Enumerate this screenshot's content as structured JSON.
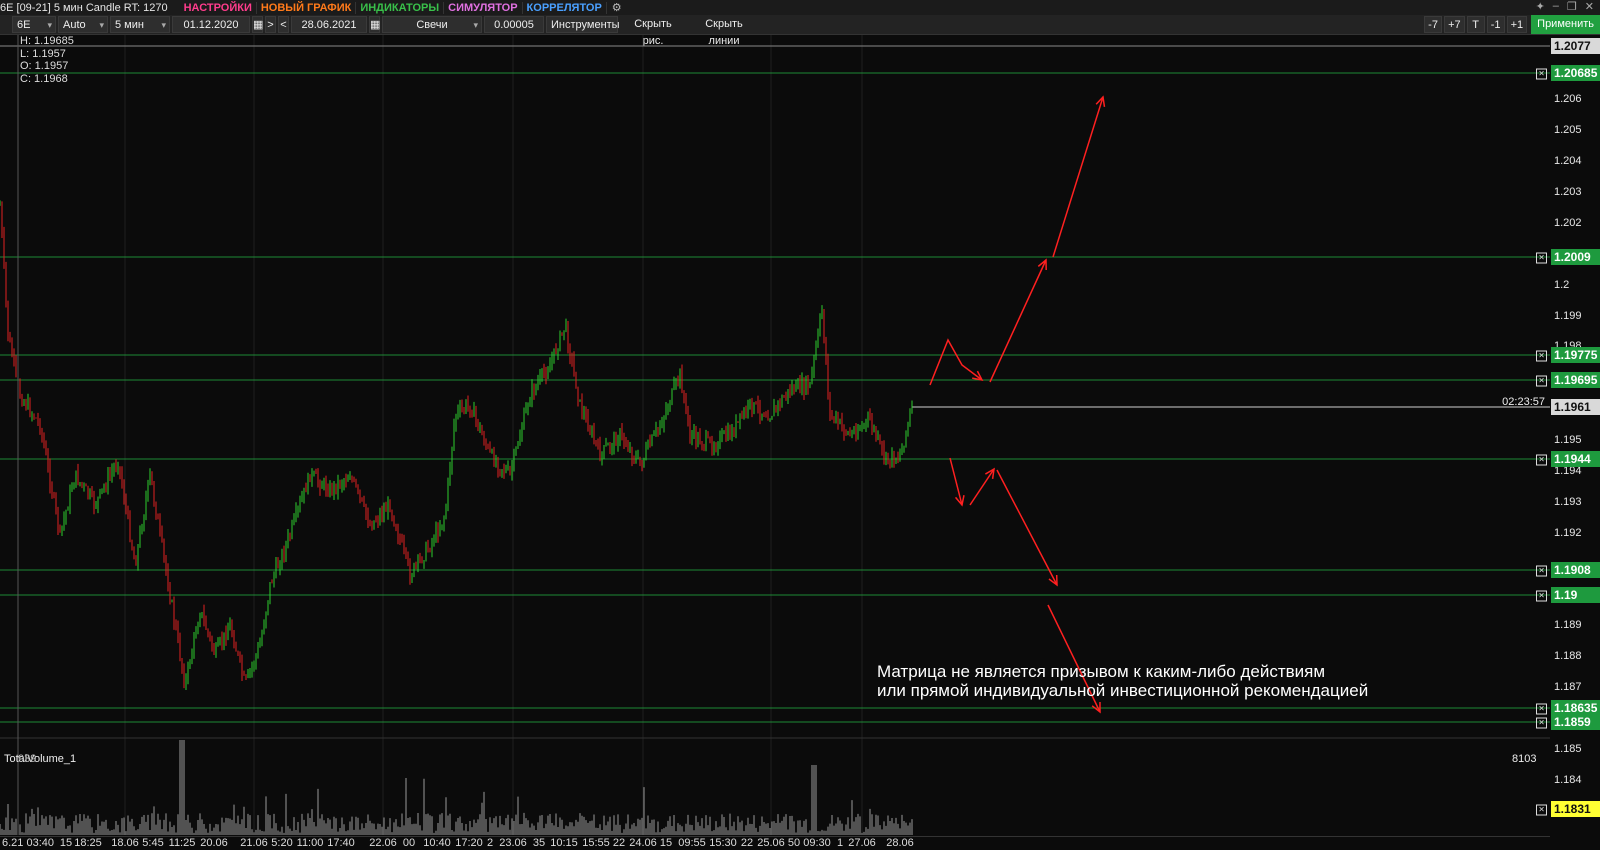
{
  "titlebar": {
    "title": "6E [09-21] 5 мин Candle RT: 1270",
    "menu": [
      {
        "label": "НАСТРОЙКИ",
        "color": "#ff3c8c"
      },
      {
        "label": "НОВЫЙ ГРАФИК",
        "color": "#ff7a1a"
      },
      {
        "label": "ИНДИКАТОРЫ",
        "color": "#39c04a"
      },
      {
        "label": "СИМУЛЯТОР",
        "color": "#e070e0"
      },
      {
        "label": "КОРРЕЛЯТОР",
        "color": "#4aa0ff"
      }
    ]
  },
  "toolbar": {
    "symbol": "6E",
    "scale": "Auto",
    "timeframe": "5 мин",
    "date_from": "01.12.2020",
    "nav_next": ">",
    "nav_prev": "<",
    "date_to": "28.06.2021",
    "chart_type": "Свечи",
    "tick_size": "0.00005",
    "instruments": "Инструменты",
    "hide_drawings": "Скрыть рис.",
    "hide_lines": "Скрыть линии",
    "shift_buttons": [
      "-7",
      "+7",
      "T",
      "-1",
      "+1"
    ],
    "apply": "Применить"
  },
  "ohlc": {
    "high": "H: 1.19685",
    "low": "L: 1.1957",
    "open": "O: 1.1957",
    "close": "C: 1.1968"
  },
  "price_axis": {
    "ticks": [
      "1.206",
      "1.205",
      "1.204",
      "1.203",
      "1.202",
      "1.2",
      "1.199",
      "1.198",
      "1.195",
      "1.194",
      "1.193",
      "1.192",
      "1.189",
      "1.188",
      "1.187",
      "1.185",
      "1.184"
    ],
    "levels": [
      {
        "label": "1.2077",
        "style": "gray"
      },
      {
        "label": "1.20685",
        "style": "green"
      },
      {
        "label": "1.2009",
        "style": "green"
      },
      {
        "label": "1.19775",
        "style": "green"
      },
      {
        "label": "1.19695",
        "style": "green"
      },
      {
        "label": "1.1961",
        "style": "gray"
      },
      {
        "label": "1.1944",
        "style": "green"
      },
      {
        "label": "1.1908",
        "style": "green"
      },
      {
        "label": "1.19",
        "style": "green"
      },
      {
        "label": "1.18635",
        "style": "green"
      },
      {
        "label": "1.1859",
        "style": "green"
      },
      {
        "label": "1.1831",
        "style": "yellow"
      }
    ]
  },
  "timer": "02:23:57",
  "note": {
    "line1": "Матрица не является призывом к каким-либо действиям",
    "line2": "или прямой индивидуальной инвестиционной рекомендацией"
  },
  "volume": {
    "label": "TotalVolume_1",
    "overlap_label": "939",
    "max": "8103"
  },
  "time_axis": [
    "6.21 03:40",
    "15",
    "18:25",
    "18.06",
    "5:45",
    "11:25",
    "20.06",
    "21.06",
    "5:20",
    "11:00",
    "17:40",
    "22.06",
    "00",
    "10:40",
    "17:20",
    "2",
    "23.06",
    "35",
    "10:15",
    "15:55",
    "22",
    "24.06",
    "15",
    "09:55",
    "15:30",
    "22",
    "25.06",
    "50",
    "09:30",
    "1",
    "27.06",
    "28.06"
  ],
  "colors": {
    "up": "#2ecc2e",
    "down": "#e02020",
    "level_line": "#1e8a36",
    "arrow": "#ff2020",
    "accent_green": "#1e9a3e"
  }
}
